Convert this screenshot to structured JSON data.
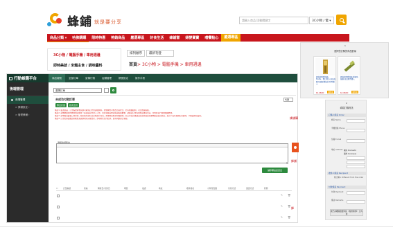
{
  "site": {
    "logo_text": "蜂鋪",
    "logo_slogan": "就是要分享",
    "search_placeholder": "請輸入商品/活動關鍵字",
    "search_scope": "3C小物 / 電 ▾",
    "nav": [
      "商品分類 ▾",
      "哈佛購購",
      "限時特惠",
      "熱銷商品",
      "嚴選專區",
      "好食生活",
      "蜂鋪嘗",
      "婦嬰寶寶",
      "嚐饗點心",
      "嚴選專區"
    ]
  },
  "category": {
    "title": "3C小物 / 電腦手機 / 車用週邊",
    "subtitle": "即時美誌 / 米麵主食 / 調味醬料",
    "sort_label": "排列順序",
    "sort_value": "最新刊登",
    "breadcrumb_home": "首頁",
    "breadcrumb_rest": "> 3C小物 > 電腦手機 > 車用週邊"
  },
  "admin": {
    "brand": "行動蜂購平台",
    "tabs": [
      "商品總覽",
      "全部訂單",
      "宣傳行銷",
      "店舖管理",
      "帳號設定",
      "操作手冊"
    ],
    "sidebar": {
      "title": "後端管理",
      "items": [
        {
          "label": "商場管理",
          "active": true
        },
        {
          "label": "> 蜂鋪設定 ›"
        },
        {
          "label": "> 管理蜂鋪 ›"
        }
      ]
    },
    "select_label": "選擇訂單",
    "list_title": "未成功付款訂單",
    "filter": "代碼",
    "buttons": [
      "匯出訂單",
      "批次出貨"
    ],
    "notes": [
      "備註1: 點選商品、訂單編號與會員即可取得訂單的詳細資料，狀態欄位可修改出貨狀況、若有相關疑問，可洽蜂鋪客服。",
      "備註2: 請依據最新的物流規定處理『超商取貨付款』訂單，若有特殊需求請先與客服聯繫，請確認訂單內容無誤後再出貨，否則將自行負擔相關費用。",
      "備註3: 請勿擅自變更訂單狀態，經系統查證有惡意修改行為者，將依會員條款停權處理，若訂單出貨後遇退貨請先與買家聯繫確認退貨原因，出貨人員有義務配合處理，以維護交易品質。",
      "備註4: 訂單若超過鑑賞期後無異議即視為完成交易，款項將於次月結算，如有問題請洽客服。"
    ],
    "editor_label": "選擇電話別註",
    "save_label": "儲存備註並送出",
    "table_headers": [
      "訂單編號",
      "會員",
      "購買日/付款日",
      "項目",
      "電話",
      "地址",
      "收件姓名",
      "小件包包數",
      "付款方式",
      "運送方式",
      "狀態"
    ],
    "row_icons": [
      "✎",
      "🗑"
    ]
  },
  "peek": {
    "text_a": "蜂鋪購",
    "text_b": "蜂鋪",
    "text_c": "蜂"
  },
  "cart": {
    "num": "1",
    "title": "選擇您訂購的商品數量",
    "products": [
      {
        "text": "經典款附贈漆器、Matte、開口時計 商品加購 防窺保護貼款 附件購入",
        "price": "$14600",
        "tag": "購物車"
      },
      {
        "text": "經典款附贈漆器 撕貼防窺模 商品附件購入",
        "price": "$14600",
        "tag": "購物車"
      }
    ]
  },
  "order": {
    "num": "2",
    "title": "填寫訂購資訊",
    "buyer_head": "訂購人資訊 Order",
    "fields": [
      {
        "label": "姓名 Name"
      },
      {
        "label": "手機號碼 Phone"
      },
      {
        "label": "信箱 E-mail"
      },
      {
        "label": "地址 Address"
      }
    ],
    "domestic": "國內 Domestic",
    "overseas": "國外 Overseas",
    "recipient_head": "收件人資訊 Recipient",
    "recipient_opt": "同訂購人 Different from the order",
    "payment_head": "付款資訊 Payment",
    "payment_label": "付款 Payment",
    "remarks_label": "備註 Remarks",
    "submit": "我已詳細閱讀並同意 【使用條款】 之內容"
  }
}
